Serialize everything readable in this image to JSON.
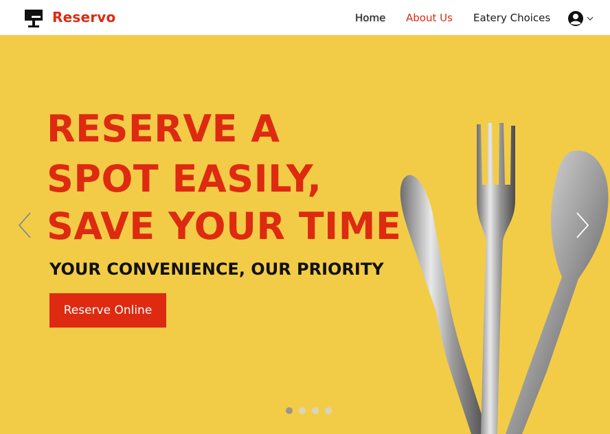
{
  "brand": {
    "name": "Reservo",
    "logo_icon": "reservation-sign-icon",
    "accent": "#dd2a10"
  },
  "nav": {
    "items": [
      {
        "label": "Home"
      },
      {
        "label": "About Us",
        "active": true
      },
      {
        "label": "Eatery Choices"
      }
    ],
    "account_icon": "user-avatar-icon",
    "dropdown_icon": "chevron-down-icon"
  },
  "hero": {
    "background": "#f3cc47",
    "headline": [
      "RESERVE A",
      "SPOT EASILY,",
      "SAVE YOUR TIME"
    ],
    "subheadline": "YOUR CONVENIENCE, OUR PRIORITY",
    "cta_label": "Reserve Online",
    "image": "cutlery-knife-fork-spoon",
    "prev_icon": "chevron-left-icon",
    "next_icon": "chevron-right-icon",
    "slides": 4,
    "active_slide": 1
  }
}
